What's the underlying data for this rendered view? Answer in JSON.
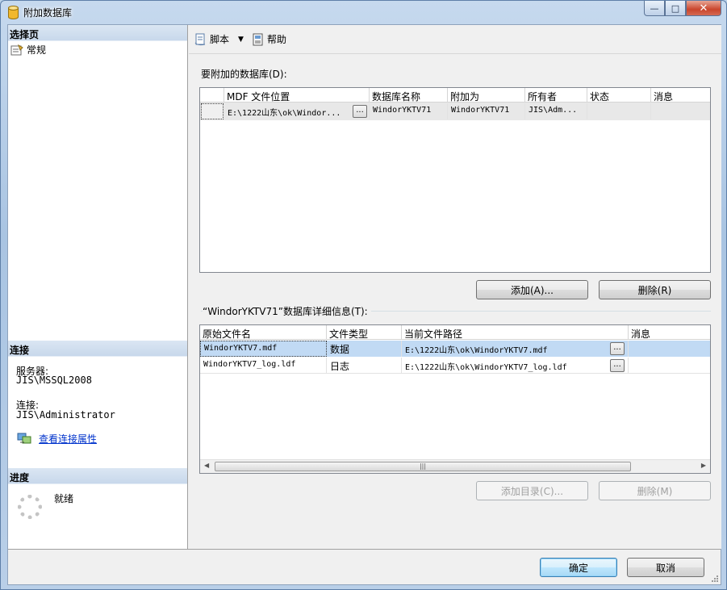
{
  "window": {
    "title": "附加数据库"
  },
  "left": {
    "select_page_header": "选择页",
    "nav_general": "常规",
    "connection_header": "连接",
    "server_label": "服务器:",
    "server_value": "JIS\\MSSQL2008",
    "connection_label": "连接:",
    "connection_value": "JIS\\Administrator",
    "view_props_link": "查看连接属性",
    "progress_header": "进度",
    "progress_status": "就绪"
  },
  "toolbar": {
    "script_label": "脚本",
    "help_label": "帮助"
  },
  "attach_grid": {
    "label": "要附加的数据库(D):",
    "columns": [
      "MDF 文件位置",
      "数据库名称",
      "附加为",
      "所有者",
      "状态",
      "消息"
    ],
    "rows": [
      {
        "mdf": "E:\\1222山东\\ok\\Windor...",
        "db_name": "WindorYKTV71",
        "attach_as": "WindorYKTV71",
        "owner": "JIS\\Adm...",
        "status": "",
        "message": ""
      }
    ],
    "add_button": "添加(A)...",
    "remove_button": "删除(R)"
  },
  "details_grid": {
    "label": "“WindorYKTV71”数据库详细信息(T):",
    "columns": [
      "原始文件名",
      "文件类型",
      "当前文件路径",
      "消息"
    ],
    "rows": [
      {
        "file": "WindorYKTV7.mdf",
        "type": "数据",
        "path": "E:\\1222山东\\ok\\WindorYKTV7.mdf",
        "message": ""
      },
      {
        "file": "WindorYKTV7_log.ldf",
        "type": "日志",
        "path": "E:\\1222山东\\ok\\WindorYKTV7_log.ldf",
        "message": ""
      }
    ],
    "add_catalog_button": "添加目录(C)...",
    "remove_button": "删除(M)"
  },
  "footer": {
    "ok_button": "确定",
    "cancel_button": "取消"
  }
}
